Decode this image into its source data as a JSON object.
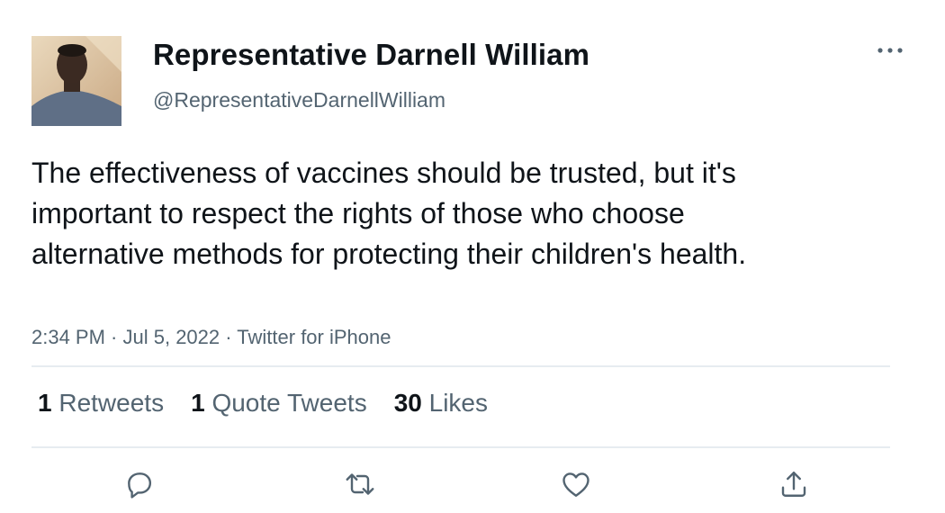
{
  "author": {
    "name": "Representative Darnell William",
    "handle": "@RepresentativeDarnellWilliam",
    "avatar_icon": "profile-photo"
  },
  "tweet": {
    "text": "The effectiveness of vaccines should be trusted, but it's important to respect the rights of those who choose alternative methods for protecting their children's health."
  },
  "meta": {
    "time": "2:34 PM",
    "separator": " · ",
    "date": "Jul 5, 2022",
    "source": "Twitter for iPhone"
  },
  "stats": {
    "retweets_count": "1",
    "retweets_label": "Retweets",
    "quotes_count": "1",
    "quotes_label": "Quote Tweets",
    "likes_count": "30",
    "likes_label": "Likes"
  },
  "actions": [
    "reply-icon",
    "retweet-icon",
    "like-icon",
    "share-icon"
  ],
  "colors": {
    "text_primary": "#0f1419",
    "text_secondary": "#536471",
    "divider": "#e6ecf0"
  }
}
